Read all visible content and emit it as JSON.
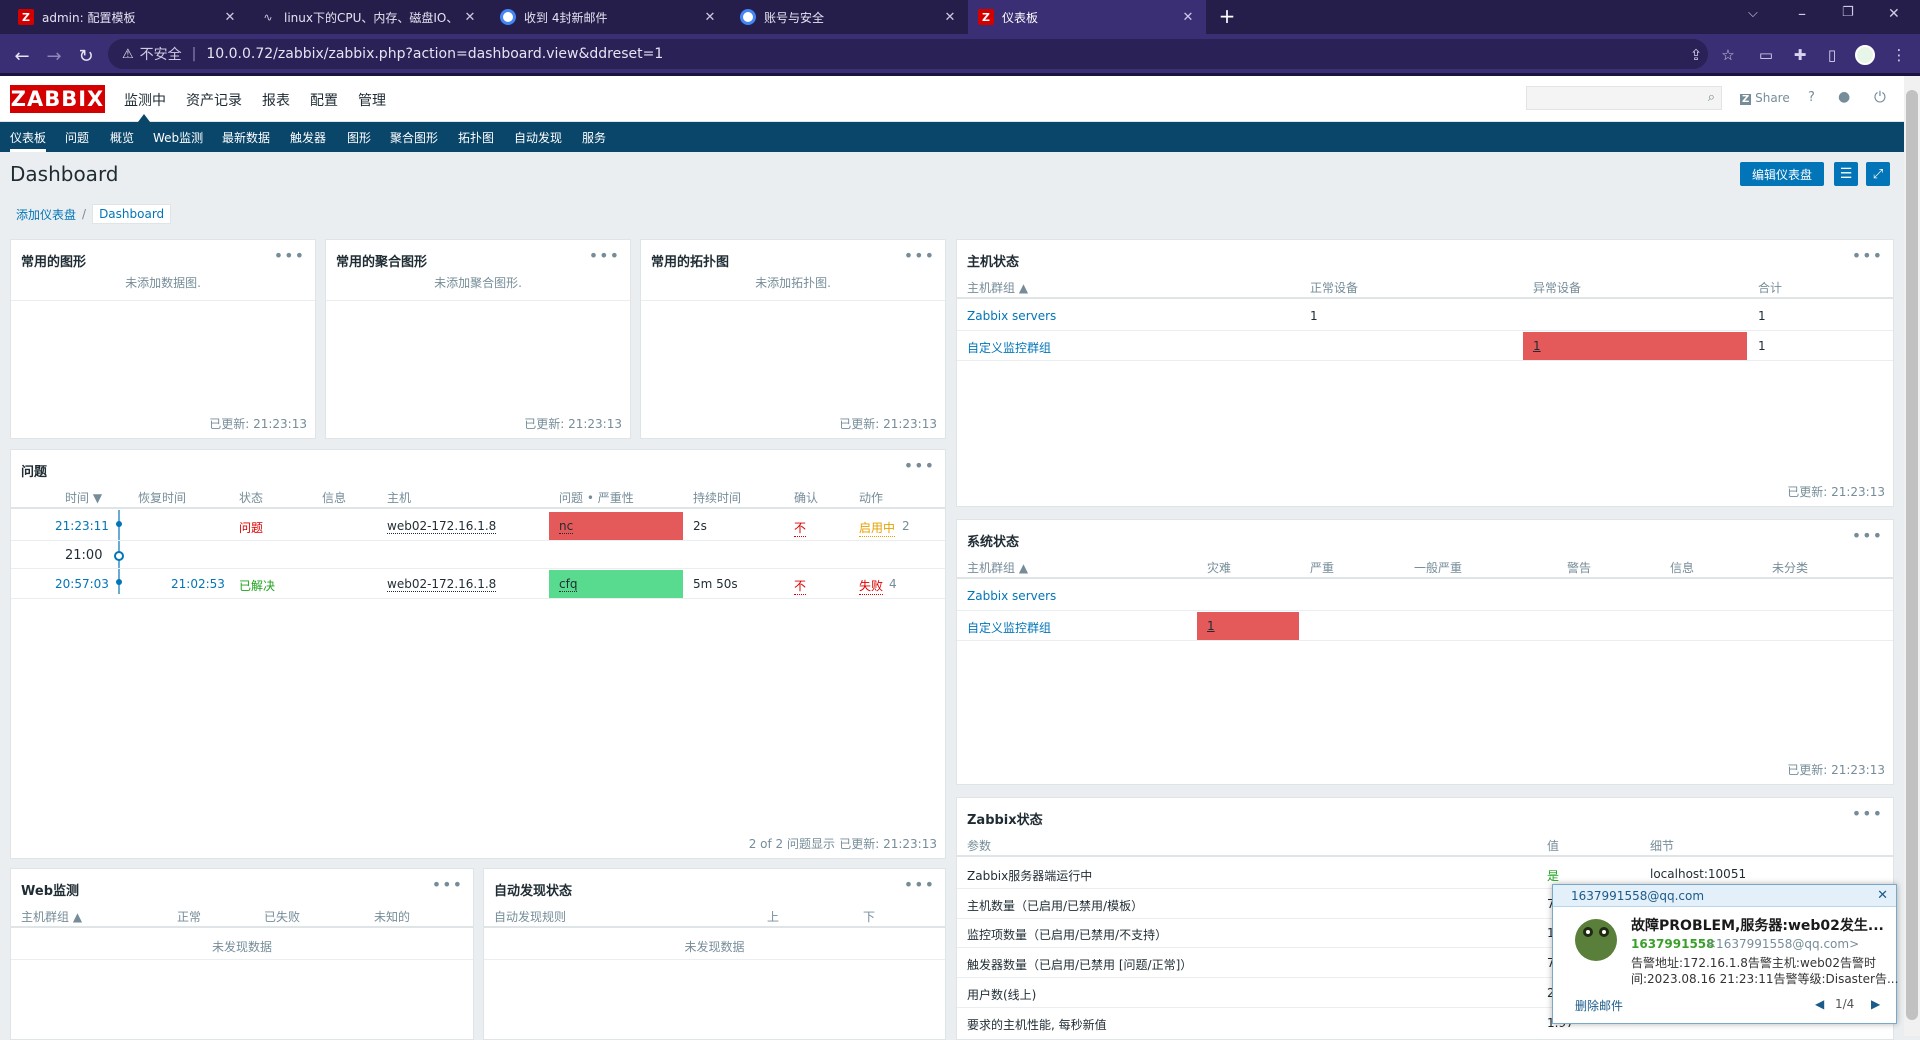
{
  "browser": {
    "tabs": [
      {
        "label": "admin: 配置模板",
        "favicon": "Z"
      },
      {
        "label": "linux下的CPU、内存、磁盘IO、",
        "favicon": ""
      },
      {
        "label": "收到 4封新邮件",
        "favicon": ""
      },
      {
        "label": "账号与安全",
        "favicon": ""
      },
      {
        "label": "仪表板",
        "favicon": "Z"
      }
    ],
    "insecure_label": "不安全",
    "url": "10.0.0.72/zabbix/zabbix.php?action=dashboard.view&ddreset=1"
  },
  "header": {
    "logo": "ZABBIX",
    "menu": [
      "监测中",
      "资产记录",
      "报表",
      "配置",
      "管理"
    ],
    "share_label": "Share",
    "help_label": "?"
  },
  "submenu": [
    "仪表板",
    "问题",
    "概览",
    "Web监测",
    "最新数据",
    "触发器",
    "图形",
    "聚合图形",
    "拓扑图",
    "自动发现",
    "服务"
  ],
  "page": {
    "title": "Dashboard",
    "edit_button": "编辑仪表盘",
    "breadcrumb": [
      "添加仪表盘",
      "Dashboard"
    ]
  },
  "widgets": {
    "graphs": {
      "title": "常用的图形",
      "empty": "未添加数据图.",
      "updated": "已更新: 21:23:13"
    },
    "screens": {
      "title": "常用的聚合图形",
      "empty": "未添加聚合图形.",
      "updated": "已更新: 21:23:13"
    },
    "maps": {
      "title": "常用的拓扑图",
      "empty": "未添加拓扑图.",
      "updated": "已更新: 21:23:13"
    },
    "host_status": {
      "title": "主机状态",
      "headers": [
        "主机群组 ▲",
        "正常设备",
        "异常设备",
        "合计"
      ],
      "rows": [
        {
          "group": "Zabbix servers",
          "ok": "1",
          "problem": "",
          "total": "1"
        },
        {
          "group": "自定义监控群组",
          "ok": "",
          "problem": "1",
          "total": "1"
        }
      ],
      "updated": "已更新: 21:23:13"
    },
    "problems": {
      "title": "问题",
      "headers": [
        "时间 ▼",
        "恢复时间",
        "状态",
        "信息",
        "主机",
        "问题 • 严重性",
        "持续时间",
        "确认",
        "动作"
      ],
      "rows": [
        {
          "time": "21:23:11",
          "recovery": "",
          "status": "问题",
          "host": "web02-172.16.1.8",
          "problem": "nc",
          "duration": "2s",
          "ack": "不",
          "action": "启用中",
          "action_count": "2"
        },
        {
          "time": "20:57:03",
          "recovery": "21:02:53",
          "status": "已解决",
          "host": "web02-172.16.1.8",
          "problem": "cfq",
          "duration": "5m 50s",
          "ack": "不",
          "action": "失败",
          "action_count": "4"
        }
      ],
      "time_marker": "21:00",
      "footer_count": "2 of 2 问题显示",
      "updated": "已更新: 21:23:13"
    },
    "system_status": {
      "title": "系统状态",
      "headers": [
        "主机群组 ▲",
        "灾难",
        "严重",
        "一般严重",
        "警告",
        "信息",
        "未分类"
      ],
      "rows": [
        {
          "group": "Zabbix servers",
          "disaster": ""
        },
        {
          "group": "自定义监控群组",
          "disaster": "1"
        }
      ],
      "updated": "已更新: 21:23:13"
    },
    "web": {
      "title": "Web监测",
      "headers": [
        "主机群组 ▲",
        "正常",
        "已失败",
        "未知的"
      ],
      "empty": "未发现数据"
    },
    "discovery": {
      "title": "自动发现状态",
      "headers": [
        "自动发现规则",
        "上",
        "下"
      ],
      "empty": "未发现数据"
    },
    "zabbix_status": {
      "title": "Zabbix状态",
      "headers": [
        "参数",
        "值",
        "细节"
      ],
      "rows": [
        {
          "param": "Zabbix服务器端运行中",
          "value": "是",
          "detail": "localhost:10051"
        },
        {
          "param": "主机数量（已启用/已禁用/模板）",
          "value": "7",
          "detail": ""
        },
        {
          "param": "监控项数量（已启用/已禁用/不支持）",
          "value": "1",
          "detail": ""
        },
        {
          "param": "触发器数量（已启用/已禁用 [问题/正常]）",
          "value": "7",
          "detail": ""
        },
        {
          "param": "用户数(线上)",
          "value": "2",
          "detail": ""
        },
        {
          "param": "要求的主机性能, 每秒新值",
          "value": "1.97",
          "detail": ""
        }
      ]
    }
  },
  "mail_popup": {
    "from_addr": "1637991558@qq.com",
    "subject": "故障PROBLEM,服务器:web02发生...",
    "sender_name": "1637991558",
    "sender_email": "<1637991558@qq.com>",
    "line1": "告警地址:172.16.1.8告警主机:web02告警时",
    "line2": "间:2023.08.16 21:23:11告警等级:Disaster告...",
    "delete_label": "删除邮件",
    "pager": "1/4"
  },
  "colors": {
    "zabbix_red": "#d40000",
    "nav_blue": "#0a466a",
    "link_blue": "#0275b8",
    "disaster": "#e45959",
    "resolved": "#59db8f"
  }
}
